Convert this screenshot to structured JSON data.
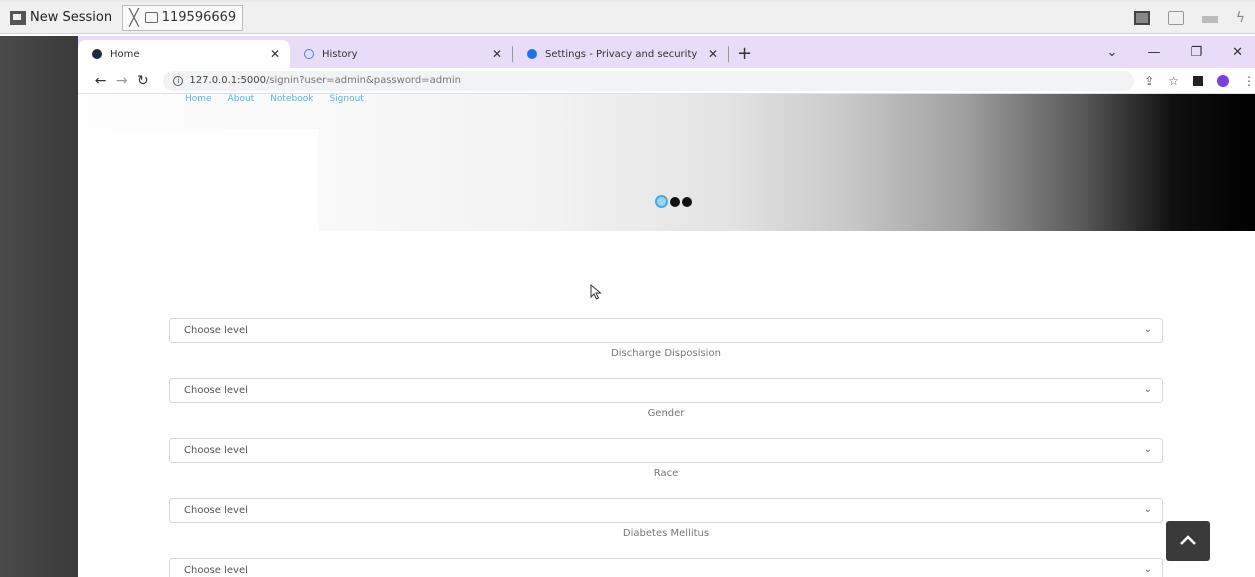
{
  "host": {
    "title": "New Session",
    "tab_label": "119596669"
  },
  "browser": {
    "tabs": [
      {
        "label": "Home",
        "icon": "database-icon"
      },
      {
        "label": "History",
        "icon": "history-icon"
      },
      {
        "label": "Settings - Privacy and security",
        "icon": "gear-icon"
      }
    ],
    "url_host": "127.0.0.1:5000",
    "url_path": "/signin?user=admin&password=admin"
  },
  "site": {
    "nav": [
      "Home",
      "About",
      "Notebook",
      "Signout"
    ],
    "accent_color": "#56b7e6"
  },
  "form": {
    "fields": [
      {
        "placeholder": "Choose level",
        "label": "Discharge Disposision"
      },
      {
        "placeholder": "Choose level",
        "label": "Gender"
      },
      {
        "placeholder": "Choose level",
        "label": "Race"
      },
      {
        "placeholder": "Choose level",
        "label": "Diabetes Mellitus"
      },
      {
        "placeholder": "Choose level",
        "label": ""
      }
    ]
  }
}
